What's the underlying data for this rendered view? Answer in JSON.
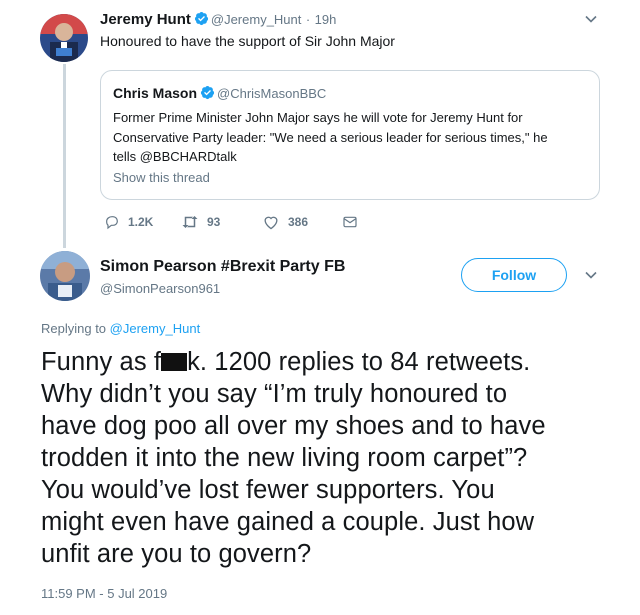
{
  "tweet": {
    "author_name": "Jeremy Hunt",
    "author_handle": "@Jeremy_Hunt",
    "separator": "·",
    "time": "19h",
    "text": "Honoured to have the support of Sir John Major",
    "quoted": {
      "author_name": "Chris Mason",
      "author_handle": "@ChrisMasonBBC",
      "text_lines": [
        "Former Prime Minister John Major says he will vote for Jeremy Hunt for",
        "Conservative Party leader: \"We need a serious leader for serious times,\" he",
        "tells @BBCHARDtalk"
      ],
      "show_thread": "Show this thread"
    },
    "actions": {
      "replies": "1.2K",
      "retweets": "93",
      "likes": "386"
    }
  },
  "reply": {
    "author_name": "Simon Pearson #Brexit Party FB",
    "author_handle": "@SimonPearson961",
    "follow_label": "Follow",
    "replying_to_prefix": "Replying to",
    "replying_to_handle": "@Jeremy_Hunt",
    "text_before_redaction": "Funny as f",
    "text_after_redaction": "k. 1200 replies to 84 retweets.",
    "text_lines": [
      "Why didn’t you say “I’m truly honoured to",
      "have dog poo all over my shoes and to have",
      "trodden it into the new living room carpet”?",
      "You would’ve lost fewer supporters. You",
      "might even have gained a couple. Just how",
      "unfit are you to govern?"
    ],
    "timestamp": "11:59 PM - 5 Jul 2019"
  },
  "colors": {
    "accent": "#1da1f2",
    "muted": "#657786",
    "border": "#ccd6dd"
  }
}
